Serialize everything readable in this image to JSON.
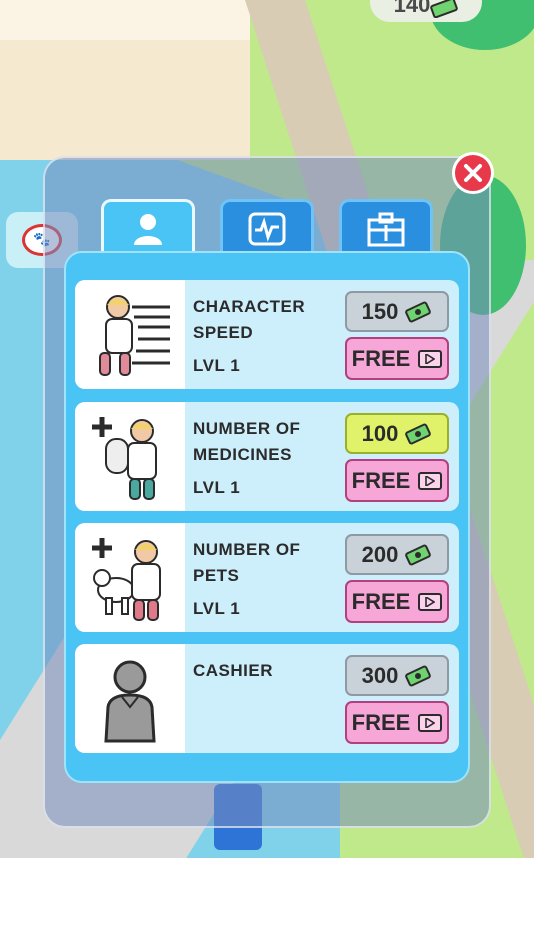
{
  "hud": {
    "money_value": "140"
  },
  "tabs": [
    {
      "icon": "person-icon",
      "active": true
    },
    {
      "icon": "monitor-icon",
      "active": false
    },
    {
      "icon": "medkit-icon",
      "active": false
    }
  ],
  "upgrades": [
    {
      "title_line1": "CHARACTER",
      "title_line2": "SPEED",
      "level": "LVL 1",
      "price": "150",
      "price_style": "grey",
      "free_label": "FREE",
      "icon": "running-doctor-icon"
    },
    {
      "title_line1": "NUMBER OF",
      "title_line2": "MEDICINES",
      "level": "LVL 1",
      "price": "100",
      "price_style": "yellow",
      "free_label": "FREE",
      "icon": "doctor-medicine-icon"
    },
    {
      "title_line1": "NUMBER OF",
      "title_line2": "PETS",
      "level": "LVL 1",
      "price": "200",
      "price_style": "grey",
      "free_label": "FREE",
      "icon": "doctor-pet-icon"
    },
    {
      "title_line1": "CASHIER",
      "title_line2": "",
      "level": "",
      "price": "300",
      "price_style": "grey",
      "free_label": "FREE",
      "icon": "cashier-silhouette-icon"
    }
  ],
  "colors": {
    "accent_blue": "#49c4f4",
    "tab_dark": "#2a8fdf",
    "free_pink": "#f7a6d8",
    "price_grey": "#c9d2d9",
    "price_yellow": "#dff26a",
    "close_red": "#e8394a"
  }
}
